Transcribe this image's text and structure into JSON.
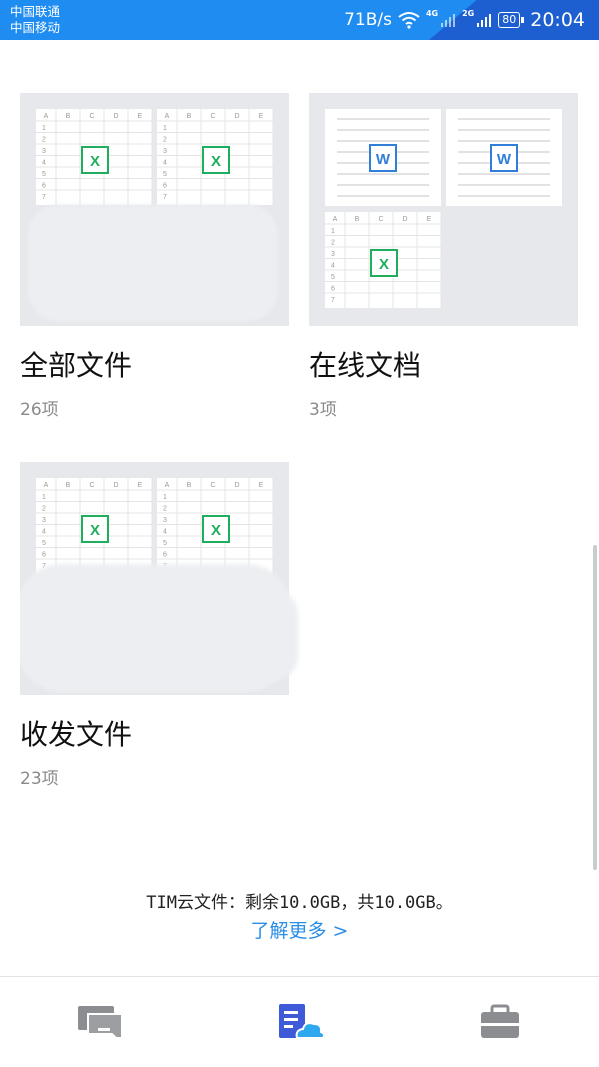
{
  "status_bar": {
    "carrier_1": "中国联通",
    "carrier_2": "中国移动",
    "net_speed": "71B/s",
    "net_4g": "4G",
    "net_2g": "2G",
    "battery": "80",
    "time": "20:04"
  },
  "folders": [
    {
      "title": "全部文件",
      "count": "26项",
      "icon": "excel-icon"
    },
    {
      "title": "在线文档",
      "count": "3项",
      "icon": "word-icon"
    },
    {
      "title": "收发文件",
      "count": "23项",
      "icon": "excel-icon"
    }
  ],
  "sheet": {
    "cols": [
      "A",
      "B",
      "C",
      "D",
      "E"
    ],
    "rows": [
      "1",
      "2",
      "3",
      "4",
      "5",
      "6",
      "7"
    ],
    "excel_glyph": "X",
    "word_glyph": "W"
  },
  "footer": {
    "storage_note": "TIM云文件：剩余10.0GB，共10.0GB。",
    "learn_more": "了解更多 >"
  },
  "tabs": [
    {
      "name": "messages-tab-icon"
    },
    {
      "name": "files-tab-icon",
      "active": true
    },
    {
      "name": "briefcase-tab-icon"
    }
  ],
  "colors": {
    "status_bar": "#1f8cf2",
    "excel_green": "#1fae5d",
    "word_blue": "#2f7ed8",
    "active_tab": "#3f5ad6",
    "inactive_tab": "#8b8d90",
    "link": "#2a8de6"
  }
}
